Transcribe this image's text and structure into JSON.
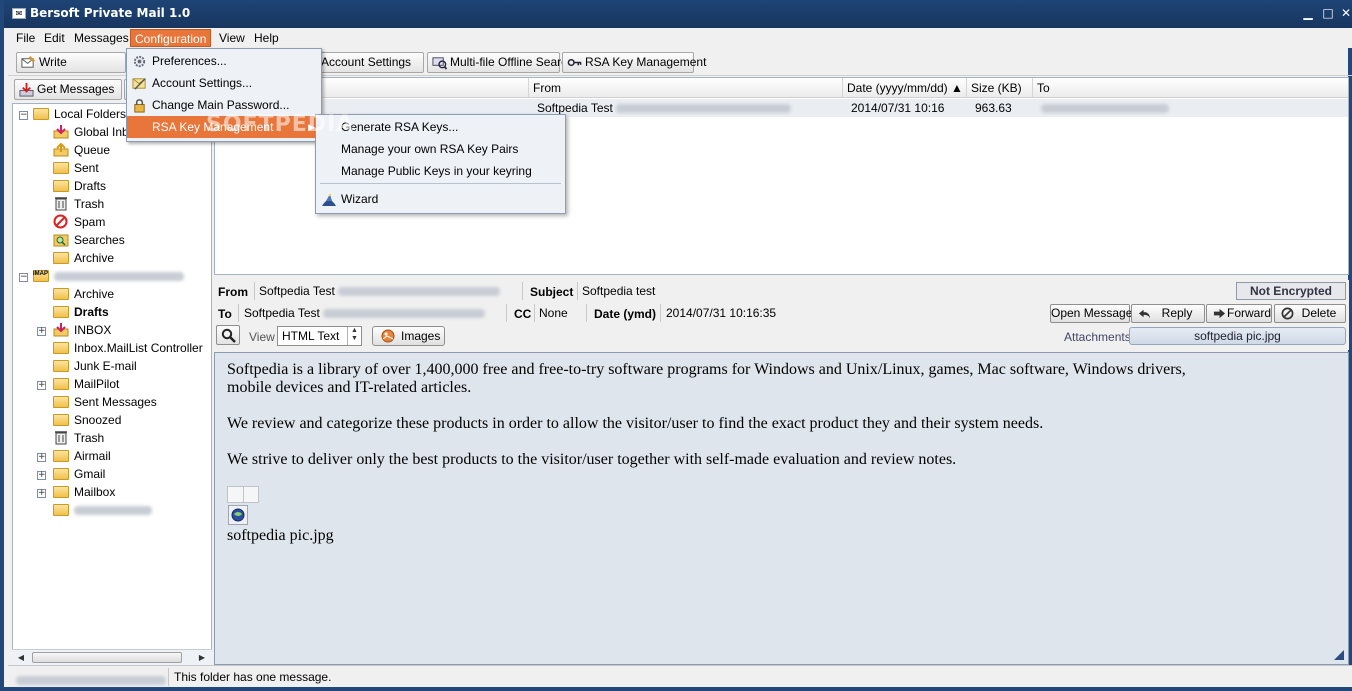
{
  "window": {
    "title": "Bersoft Private Mail 1.0",
    "icon_glyph": "✉"
  },
  "menubar": [
    "File",
    "Edit",
    "Messages",
    "Configuration",
    "View",
    "Help"
  ],
  "toolbar": {
    "write": "Write",
    "account_settings": "Account Settings",
    "offline_search": "Multi-file Offline Search",
    "rsa_key_mgmt": "RSA Key Management",
    "get_messages": "Get Messages"
  },
  "config_menu": {
    "items": [
      "Preferences...",
      "Account Settings...",
      "Change Main Password...",
      "RSA Key Management"
    ],
    "submenu_arrow": "▶"
  },
  "rsa_submenu": {
    "items": [
      "Generate RSA Keys...",
      "Manage your own RSA Key Pairs",
      "Manage Public Keys in your keyring",
      "Wizard"
    ]
  },
  "watermark": "SOFTPEDIA",
  "folders": {
    "local_root": "Local Folders",
    "local": [
      "Global Inbox",
      "Queue",
      "Sent",
      "Drafts",
      "Trash",
      "Spam",
      "Searches",
      "Archive"
    ],
    "imap_badge": "IMAP",
    "imap": [
      "Archive",
      "Drafts",
      "INBOX",
      "Inbox.MailList Controller",
      "Junk E-mail",
      "MailPilot",
      "Sent Messages",
      "Snoozed",
      "Trash",
      "Airmail",
      "Gmail",
      "Mailbox"
    ]
  },
  "message_list": {
    "columns": [
      "From",
      "Date (yyyy/mm/dd) ▲",
      "Size (KB)",
      "To"
    ],
    "rows": [
      {
        "from": "Softpedia Test",
        "date": "2014/07/31 10:16",
        "size": "963.63"
      }
    ]
  },
  "header": {
    "from_label": "From",
    "from_value": "Softpedia Test",
    "subject_label": "Subject",
    "subject_value": "Softpedia test",
    "to_label": "To",
    "to_value": "Softpedia Test",
    "cc_label": "CC",
    "cc_value": "None",
    "date_label": "Date (ymd)",
    "date_value": "2014/07/31 10:16:35",
    "encryption_status": "Not Encrypted",
    "view_label": "View",
    "view_mode": "HTML Text",
    "images_button": "Images",
    "open_message": "Open Message",
    "reply": "Reply",
    "forward": "Forward",
    "delete": "Delete",
    "attachments_label": "Attachments",
    "attachment_file": "softpedia pic.jpg"
  },
  "body": {
    "para1_line1": "Softpedia is a library of over 1,400,000 free and free-to-try software  programs for Windows and Unix/Linux, games, Mac software, Windows drivers,",
    "para1_line2": " mobile devices and IT-related articles.",
    "para2": "We review and categorize these products in order to allow the visitor/user  to find the exact product they and their system needs.",
    "para3": "We strive to deliver only the best products to the visitor/user together with self-made evaluation and review notes.",
    "image_caption": "softpedia pic.jpg"
  },
  "status": {
    "text": "This folder has one message."
  },
  "colors": {
    "accent": "#e8753a",
    "titlebar": "#1e4476",
    "body_bg": "#dfe5ec"
  }
}
